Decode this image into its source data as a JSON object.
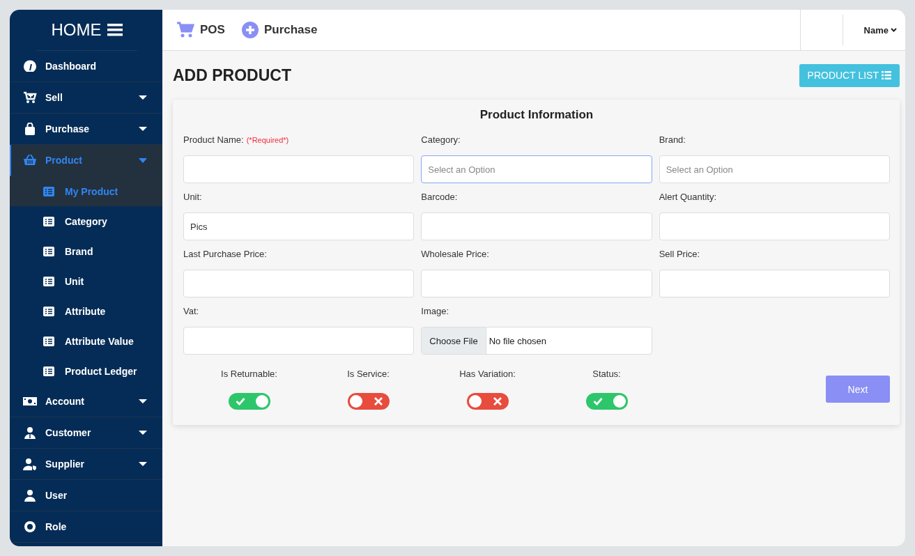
{
  "sidebar": {
    "brand": "HOME",
    "items": [
      {
        "label": "Dashboard",
        "selected": false
      },
      {
        "label": "Sell",
        "selected": false,
        "expanded": false
      },
      {
        "label": "Purchase",
        "selected": false,
        "expanded": false
      },
      {
        "label": "Product",
        "selected": true,
        "expanded": true,
        "children": [
          {
            "label": "My Product",
            "selected": true
          },
          {
            "label": "Category",
            "selected": false
          },
          {
            "label": "Brand",
            "selected": false
          },
          {
            "label": "Unit",
            "selected": false
          },
          {
            "label": "Attribute",
            "selected": false
          },
          {
            "label": "Attribute Value",
            "selected": false
          },
          {
            "label": "Product Ledger",
            "selected": false
          }
        ]
      },
      {
        "label": "Account",
        "selected": false,
        "expanded": false
      },
      {
        "label": "Customer",
        "selected": false,
        "expanded": false
      },
      {
        "label": "Supplier",
        "selected": false,
        "expanded": false
      },
      {
        "label": "User",
        "selected": false
      },
      {
        "label": "Role",
        "selected": false
      }
    ]
  },
  "topbar": {
    "links": [
      "POS",
      "Purchase"
    ],
    "user": "Name"
  },
  "page": {
    "title": "ADD PRODUCT",
    "list_button": "PRODUCT LIST"
  },
  "form": {
    "title": "Product Information",
    "fields": [
      {
        "kind": "text",
        "label": "Product Name:",
        "note": "(*Required*)",
        "focused": false
      },
      {
        "kind": "select",
        "label": "Category:",
        "placeholder": "Select an Option",
        "focused": true
      },
      {
        "kind": "select",
        "label": "Brand:",
        "placeholder": "Select an Option",
        "focused": false
      },
      {
        "kind": "text",
        "label": "Unit:",
        "value": "Pics",
        "focused": false
      },
      {
        "kind": "text",
        "label": "Barcode:",
        "focused": false
      },
      {
        "kind": "text",
        "label": "Alert Quantity:",
        "focused": false
      },
      {
        "kind": "text",
        "label": "Last Purchase Price:",
        "focused": false
      },
      {
        "kind": "text",
        "label": "Wholesale Price:",
        "focused": false
      },
      {
        "kind": "text",
        "label": "Sell Price:",
        "focused": false
      },
      {
        "kind": "text",
        "label": "Vat:",
        "focused": false
      },
      {
        "kind": "file",
        "label": "Image:",
        "button": "Choose File",
        "value": "No file chosen",
        "focused": false
      }
    ],
    "toggles": [
      {
        "label": "Is Returnable:",
        "on": true
      },
      {
        "label": "Is Service:",
        "on": false
      },
      {
        "label": "Has Variation:",
        "on": false
      },
      {
        "label": "Status:",
        "on": true
      }
    ],
    "submit": "Next"
  }
}
